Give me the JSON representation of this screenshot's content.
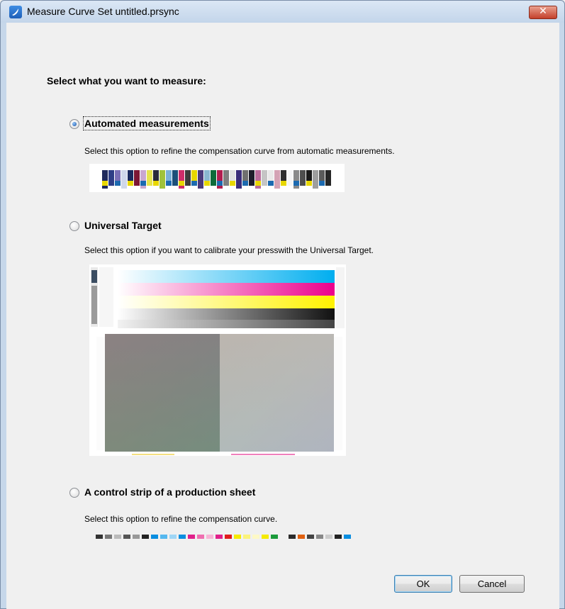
{
  "window": {
    "title": "Measure Curve Set untitled.prsync"
  },
  "heading": "Select what you want to measure:",
  "options": [
    {
      "label": "Automated measurements",
      "description": "Select this option to refine the compensation curve from automatic measurements.",
      "selected": true
    },
    {
      "label": "Universal Target",
      "description": "Select this option if you want to calibrate your presswith the Universal Target.",
      "selected": false
    },
    {
      "label": "A control strip of a production sheet",
      "description": "Select this option to refine the compensation curve.",
      "selected": false
    }
  ],
  "buttons": {
    "ok": "OK",
    "cancel": "Cancel"
  },
  "icons": {
    "app": "app-icon",
    "close": "close-icon",
    "radio": "radio-icon"
  },
  "colors": {
    "titlebar": "#c6d7ea",
    "close": "#c4402a",
    "background": "#f0f0f0",
    "radio_dot": "#1b4f9c"
  }
}
